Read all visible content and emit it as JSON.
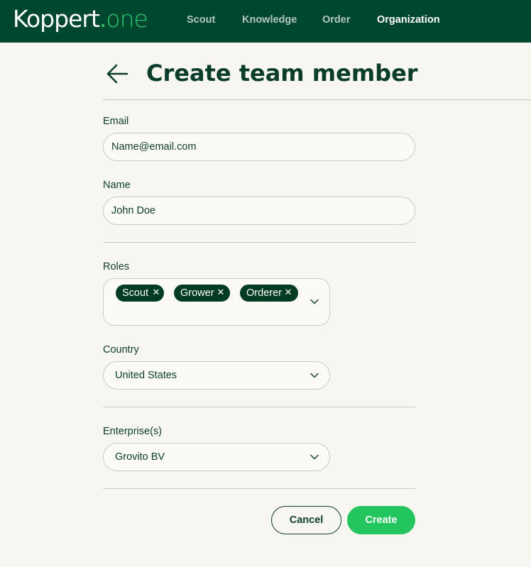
{
  "brand": {
    "name_main": "Koppert",
    "name_dot": ".",
    "name_suffix": "one"
  },
  "nav": {
    "items": [
      {
        "label": "Scout",
        "active": false
      },
      {
        "label": "Knowledge",
        "active": false
      },
      {
        "label": "Order",
        "active": false
      },
      {
        "label": "Organization",
        "active": true
      }
    ]
  },
  "page": {
    "title": "Create team member",
    "back_icon": "arrow-left-icon"
  },
  "form": {
    "email": {
      "label": "Email",
      "placeholder": "Name@email.com",
      "value": ""
    },
    "name": {
      "label": "Name",
      "value": "John Doe"
    },
    "roles": {
      "label": "Roles",
      "selected": [
        "Scout",
        "Grower",
        "Orderer"
      ],
      "remove_icon": "close-icon"
    },
    "country": {
      "label": "Country",
      "value": "United States"
    },
    "enterprise": {
      "label": "Enterprise(s)",
      "value": "Grovito BV"
    }
  },
  "actions": {
    "cancel_label": "Cancel",
    "create_label": "Create"
  },
  "colors": {
    "header_bg": "#004730",
    "accent": "#22c55e",
    "text": "#0b3d2c",
    "page_bg": "#f8f6f0",
    "chip_bg": "#003c22"
  }
}
